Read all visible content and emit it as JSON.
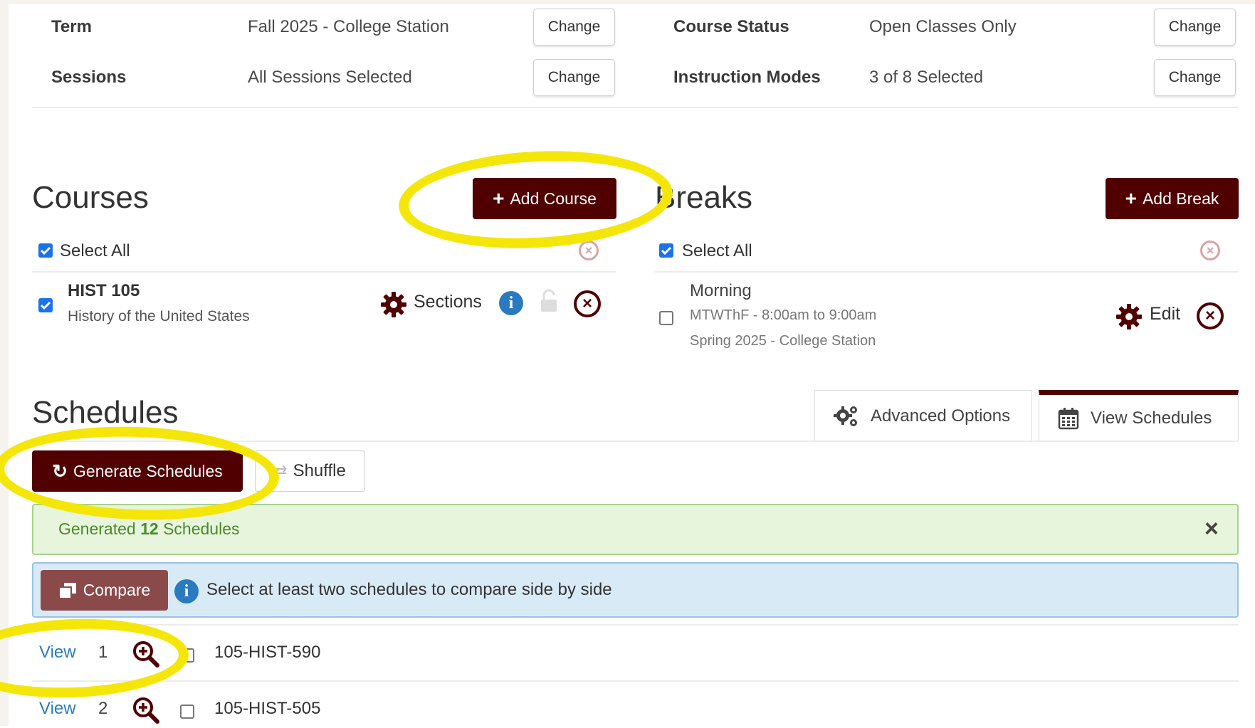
{
  "filters": {
    "term_label": "Term",
    "term_value": "Fall 2025 - College Station",
    "sessions_label": "Sessions",
    "sessions_value": "All Sessions Selected",
    "course_status_label": "Course Status",
    "course_status_value": "Open Classes Only",
    "instruction_modes_label": "Instruction Modes",
    "instruction_modes_value": "3 of 8 Selected",
    "change_label": "Change"
  },
  "courses": {
    "title": "Courses",
    "add_label": "Add Course",
    "select_all_label": "Select All",
    "items": [
      {
        "code": "HIST 105",
        "name": "History of the United States",
        "sections_label": "Sections"
      }
    ]
  },
  "breaks": {
    "title": "Breaks",
    "add_label": "Add Break",
    "select_all_label": "Select All",
    "items": [
      {
        "name": "Morning",
        "time": "MTWThF - 8:00am to 9:00am",
        "term": "Spring 2025 - College Station",
        "edit_label": "Edit"
      }
    ]
  },
  "schedules": {
    "title": "Schedules",
    "tabs": {
      "advanced_label": "Advanced Options",
      "view_label": "View Schedules"
    },
    "generate_label": "Generate Schedules",
    "shuffle_label": "Shuffle",
    "success_prefix": "Generated ",
    "success_count": "12",
    "success_suffix": " Schedules",
    "compare_label": "Compare",
    "compare_hint": "Select at least two schedules to compare side by side",
    "rows": [
      {
        "view_label": "View",
        "number": "1",
        "name": "105-HIST-590"
      },
      {
        "view_label": "View",
        "number": "2",
        "name": "105-HIST-505"
      }
    ]
  },
  "colors": {
    "maroon": "#500000",
    "highlight": "#f5e60a",
    "success_bg": "#e7f5dd",
    "info_bg": "#d9eaf7",
    "link": "#2a7abf"
  }
}
